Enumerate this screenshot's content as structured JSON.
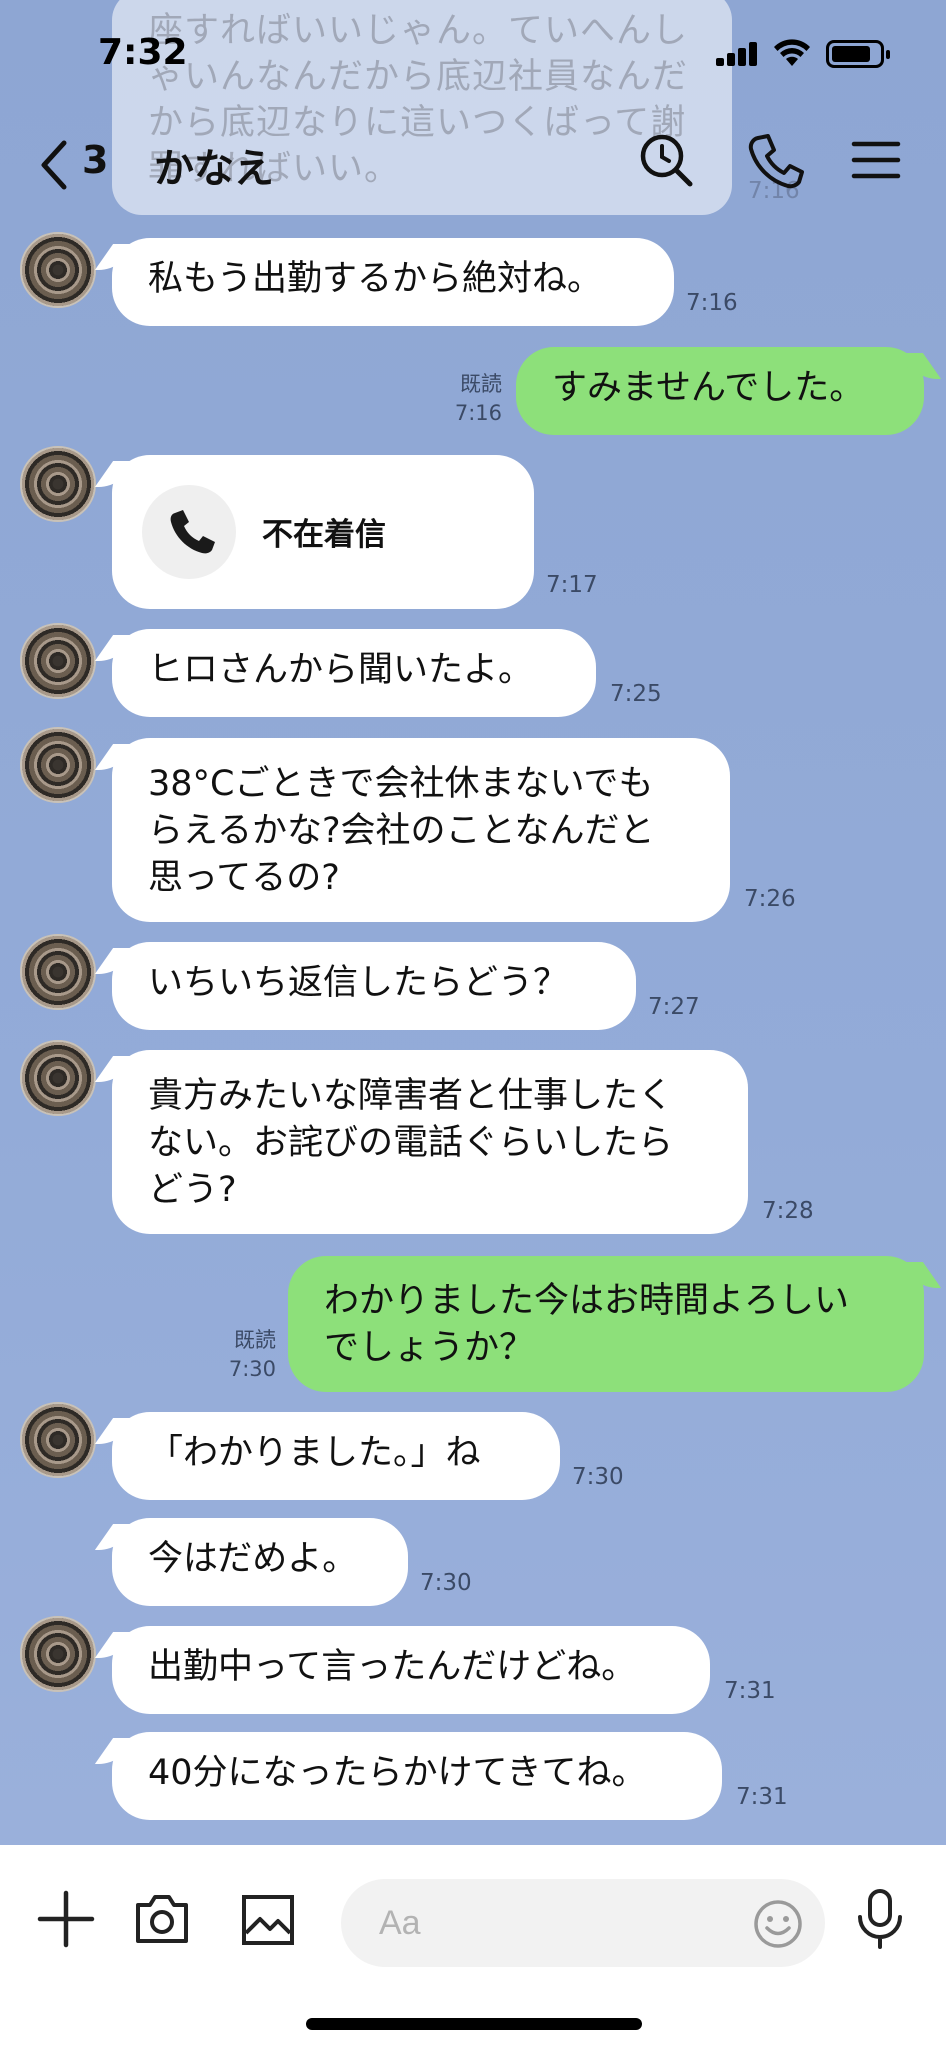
{
  "status_bar": {
    "time": "7:32"
  },
  "header": {
    "back_count": "3",
    "contact_name": "かなえ",
    "icons": [
      "back-chevron-icon",
      "search-icon",
      "phone-icon",
      "menu-icon"
    ]
  },
  "ghost_message": {
    "text": "座すればいいじゃん。ていへんしゃいんなんだから底辺社員なんだから底辺なりに這いつくばって謝罪すればいい。",
    "time": "7:16"
  },
  "messages": [
    {
      "dir": "in",
      "text": "私もう出勤するから絶対ね。",
      "time": "7:16"
    },
    {
      "dir": "out",
      "text": "すみませんでした。",
      "read": "既読",
      "time": "7:16"
    },
    {
      "dir": "in",
      "type": "missed-call",
      "text": "不在着信",
      "time": "7:17"
    },
    {
      "dir": "in",
      "text": "ヒロさんから聞いたよ。",
      "time": "7:25"
    },
    {
      "dir": "in",
      "lines": [
        "38°Cごときで会社休まないでも",
        "らえるかな?会社のことなんだと",
        "思ってるの?"
      ],
      "time": "7:26"
    },
    {
      "dir": "in",
      "text": "いちいち返信したらどう？",
      "time": "7:27"
    },
    {
      "dir": "in",
      "lines": [
        "貴方みたいな障害者と仕事したく",
        "ない。お詫びの電話ぐらいしたら",
        "どう?"
      ],
      "time": "7:28"
    },
    {
      "dir": "out",
      "lines": [
        "わかりました今はお時間よろしい",
        "でしょうか？"
      ],
      "read": "既読",
      "time": "7:30"
    },
    {
      "dir": "in",
      "text": "「わかりました。」ね",
      "time": "7:30"
    },
    {
      "dir": "in",
      "text": "今はだめよ。",
      "time": "7:30"
    },
    {
      "dir": "in",
      "text": "出勤中って言ったんだけどね。",
      "time": "7:31"
    },
    {
      "dir": "in",
      "text": "40分になったらかけてきてね。",
      "time": "7:31"
    }
  ],
  "input_bar": {
    "placeholder": "Aa",
    "icons": [
      "plus-icon",
      "camera-icon",
      "image-icon",
      "emoji-icon",
      "microphone-icon"
    ]
  },
  "colors": {
    "chat_background": "#8fa8d6",
    "incoming_bubble": "#ffffff",
    "outgoing_bubble": "#8de07a"
  }
}
